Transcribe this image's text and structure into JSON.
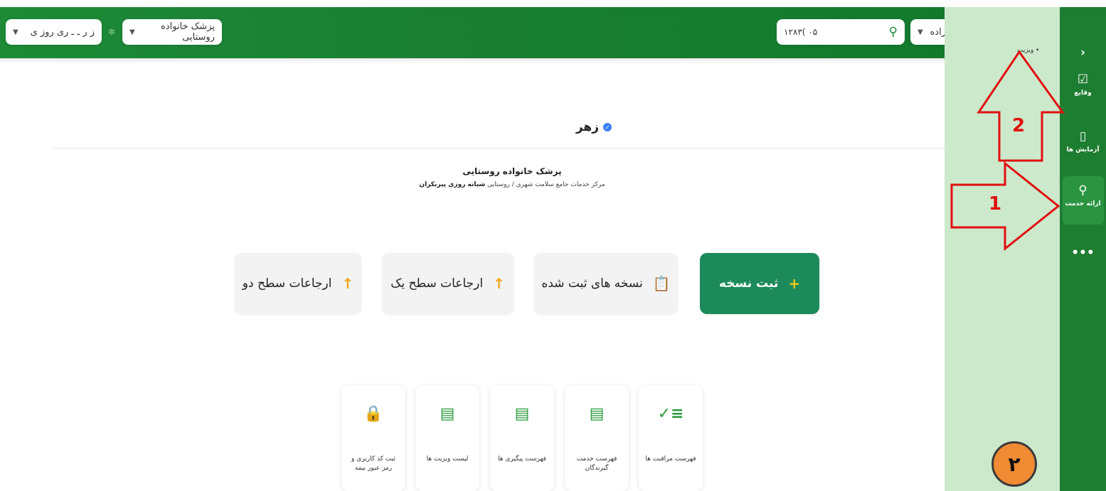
{
  "topbar": {
    "left_selector_value": "ز ر ـ ـ ری روز ی",
    "role_selector_value": "پزشک خانواده روستایی",
    "search_value": "۱۲۸۳(      ۰۵",
    "user_selector_value": "زاده"
  },
  "profile": {
    "name": "زهر",
    "role": "پزشک خانواده روستایی",
    "center_prefix": "مرکز خدمات جامع سلامت شهری / روستایی",
    "center_name": "شبانه روزی پیربکران"
  },
  "actions": [
    {
      "label": "ثبت نسخه",
      "icon": "plus-icon"
    },
    {
      "label": "نسخه های ثبت شده",
      "icon": "clipboard-icon"
    },
    {
      "label": "ارجاعات سطح یک",
      "icon": "arrow-up-icon"
    },
    {
      "label": "ارجاعات سطح دو",
      "icon": "arrow-up-icon"
    }
  ],
  "tiles": [
    {
      "label": "فهرست مراقبت ها",
      "icon": "checklist-icon"
    },
    {
      "label": "فهرست خدمت گیرندگان",
      "icon": "clipboard-icon"
    },
    {
      "label": "فهرست پیگیری ها",
      "icon": "clipboard-icon"
    },
    {
      "label": "لیست ویزیت ها",
      "icon": "clipboard-icon"
    },
    {
      "label": "ثبت کد کاربری و رمز عبور بیمه",
      "icon": "lock-icon"
    }
  ],
  "sidepanel": {
    "breadcrumb": "• ویزیت"
  },
  "rail": {
    "items": [
      {
        "label": "وقایع",
        "icon": "calendar-check-icon"
      },
      {
        "label": "آزمایش ها",
        "icon": "test-tube-icon"
      },
      {
        "label": "ارائه خدمت",
        "icon": "service-search-icon"
      }
    ]
  },
  "annotations": {
    "arrow1": "1",
    "arrow2": "2",
    "circle": "۲"
  },
  "colors": {
    "brand_green": "#1c8a37",
    "primary_button": "#1c8a5a",
    "accent_orange": "#f2a51c",
    "side_panel": "#cde9cc",
    "rail": "#1d7d31"
  }
}
